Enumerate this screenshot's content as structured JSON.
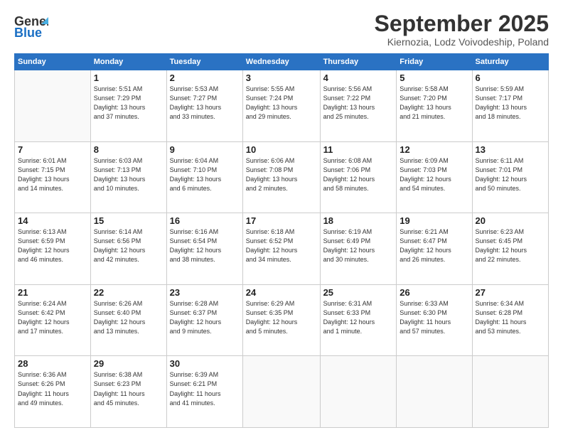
{
  "header": {
    "logo_line1": "General",
    "logo_line2": "Blue",
    "month": "September 2025",
    "location": "Kiernozia, Lodz Voivodeship, Poland"
  },
  "weekdays": [
    "Sunday",
    "Monday",
    "Tuesday",
    "Wednesday",
    "Thursday",
    "Friday",
    "Saturday"
  ],
  "weeks": [
    [
      {
        "day": "",
        "info": ""
      },
      {
        "day": "1",
        "info": "Sunrise: 5:51 AM\nSunset: 7:29 PM\nDaylight: 13 hours\nand 37 minutes."
      },
      {
        "day": "2",
        "info": "Sunrise: 5:53 AM\nSunset: 7:27 PM\nDaylight: 13 hours\nand 33 minutes."
      },
      {
        "day": "3",
        "info": "Sunrise: 5:55 AM\nSunset: 7:24 PM\nDaylight: 13 hours\nand 29 minutes."
      },
      {
        "day": "4",
        "info": "Sunrise: 5:56 AM\nSunset: 7:22 PM\nDaylight: 13 hours\nand 25 minutes."
      },
      {
        "day": "5",
        "info": "Sunrise: 5:58 AM\nSunset: 7:20 PM\nDaylight: 13 hours\nand 21 minutes."
      },
      {
        "day": "6",
        "info": "Sunrise: 5:59 AM\nSunset: 7:17 PM\nDaylight: 13 hours\nand 18 minutes."
      }
    ],
    [
      {
        "day": "7",
        "info": "Sunrise: 6:01 AM\nSunset: 7:15 PM\nDaylight: 13 hours\nand 14 minutes."
      },
      {
        "day": "8",
        "info": "Sunrise: 6:03 AM\nSunset: 7:13 PM\nDaylight: 13 hours\nand 10 minutes."
      },
      {
        "day": "9",
        "info": "Sunrise: 6:04 AM\nSunset: 7:10 PM\nDaylight: 13 hours\nand 6 minutes."
      },
      {
        "day": "10",
        "info": "Sunrise: 6:06 AM\nSunset: 7:08 PM\nDaylight: 13 hours\nand 2 minutes."
      },
      {
        "day": "11",
        "info": "Sunrise: 6:08 AM\nSunset: 7:06 PM\nDaylight: 12 hours\nand 58 minutes."
      },
      {
        "day": "12",
        "info": "Sunrise: 6:09 AM\nSunset: 7:03 PM\nDaylight: 12 hours\nand 54 minutes."
      },
      {
        "day": "13",
        "info": "Sunrise: 6:11 AM\nSunset: 7:01 PM\nDaylight: 12 hours\nand 50 minutes."
      }
    ],
    [
      {
        "day": "14",
        "info": "Sunrise: 6:13 AM\nSunset: 6:59 PM\nDaylight: 12 hours\nand 46 minutes."
      },
      {
        "day": "15",
        "info": "Sunrise: 6:14 AM\nSunset: 6:56 PM\nDaylight: 12 hours\nand 42 minutes."
      },
      {
        "day": "16",
        "info": "Sunrise: 6:16 AM\nSunset: 6:54 PM\nDaylight: 12 hours\nand 38 minutes."
      },
      {
        "day": "17",
        "info": "Sunrise: 6:18 AM\nSunset: 6:52 PM\nDaylight: 12 hours\nand 34 minutes."
      },
      {
        "day": "18",
        "info": "Sunrise: 6:19 AM\nSunset: 6:49 PM\nDaylight: 12 hours\nand 30 minutes."
      },
      {
        "day": "19",
        "info": "Sunrise: 6:21 AM\nSunset: 6:47 PM\nDaylight: 12 hours\nand 26 minutes."
      },
      {
        "day": "20",
        "info": "Sunrise: 6:23 AM\nSunset: 6:45 PM\nDaylight: 12 hours\nand 22 minutes."
      }
    ],
    [
      {
        "day": "21",
        "info": "Sunrise: 6:24 AM\nSunset: 6:42 PM\nDaylight: 12 hours\nand 17 minutes."
      },
      {
        "day": "22",
        "info": "Sunrise: 6:26 AM\nSunset: 6:40 PM\nDaylight: 12 hours\nand 13 minutes."
      },
      {
        "day": "23",
        "info": "Sunrise: 6:28 AM\nSunset: 6:37 PM\nDaylight: 12 hours\nand 9 minutes."
      },
      {
        "day": "24",
        "info": "Sunrise: 6:29 AM\nSunset: 6:35 PM\nDaylight: 12 hours\nand 5 minutes."
      },
      {
        "day": "25",
        "info": "Sunrise: 6:31 AM\nSunset: 6:33 PM\nDaylight: 12 hours\nand 1 minute."
      },
      {
        "day": "26",
        "info": "Sunrise: 6:33 AM\nSunset: 6:30 PM\nDaylight: 11 hours\nand 57 minutes."
      },
      {
        "day": "27",
        "info": "Sunrise: 6:34 AM\nSunset: 6:28 PM\nDaylight: 11 hours\nand 53 minutes."
      }
    ],
    [
      {
        "day": "28",
        "info": "Sunrise: 6:36 AM\nSunset: 6:26 PM\nDaylight: 11 hours\nand 49 minutes."
      },
      {
        "day": "29",
        "info": "Sunrise: 6:38 AM\nSunset: 6:23 PM\nDaylight: 11 hours\nand 45 minutes."
      },
      {
        "day": "30",
        "info": "Sunrise: 6:39 AM\nSunset: 6:21 PM\nDaylight: 11 hours\nand 41 minutes."
      },
      {
        "day": "",
        "info": ""
      },
      {
        "day": "",
        "info": ""
      },
      {
        "day": "",
        "info": ""
      },
      {
        "day": "",
        "info": ""
      }
    ]
  ]
}
